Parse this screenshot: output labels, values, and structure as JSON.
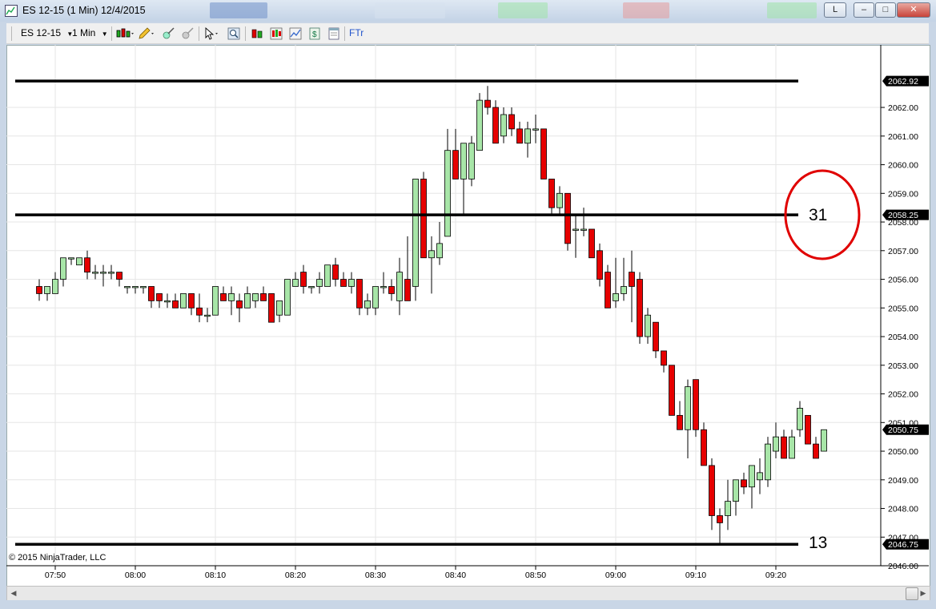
{
  "window": {
    "title": "ES 12-15 (1 Min)  12/4/2015",
    "buttons": {
      "link": "L",
      "minimize": "–",
      "maximize": "□",
      "close": "✕"
    }
  },
  "toolbar": {
    "instrument": "ES 12-15",
    "interval": "1 Min",
    "ftr_label": "FTr"
  },
  "chart": {
    "copyright": "© 2015 NinjaTrader, LLC",
    "y_ticks": [
      "2046.00",
      "2047.00",
      "2048.00",
      "2049.00",
      "2050.00",
      "2051.00",
      "2052.00",
      "2053.00",
      "2054.00",
      "2055.00",
      "2056.00",
      "2057.00",
      "2058.00",
      "2059.00",
      "2060.00",
      "2061.00",
      "2062.00"
    ],
    "x_ticks": [
      "07:50",
      "08:00",
      "08:10",
      "08:20",
      "08:30",
      "08:40",
      "08:50",
      "09:00",
      "09:10",
      "09:20"
    ],
    "price_labels": [
      "2062.92",
      "2058.25",
      "2050.75",
      "2046.75"
    ],
    "annotations": {
      "circle_value": "31",
      "bottom_value": "13"
    },
    "colors": {
      "up": "#a8e6a8",
      "down": "#e60000",
      "wick": "#000000",
      "line": "#000000",
      "circle": "#e00000"
    }
  },
  "chart_data": {
    "type": "candlestick",
    "instrument": "ES 12-15",
    "interval": "1 Min",
    "date": "12/4/2015",
    "ylim": [
      2045.8,
      2063.8
    ],
    "xlim": [
      "07:48",
      "09:35"
    ],
    "horizontal_lines": [
      2062.92,
      2058.25,
      2046.75
    ],
    "candles": [
      {
        "t": "07:48",
        "o": 2055.75,
        "h": 2056.0,
        "l": 2055.25,
        "c": 2055.5
      },
      {
        "t": "07:49",
        "o": 2055.5,
        "h": 2055.75,
        "l": 2055.25,
        "c": 2055.75
      },
      {
        "t": "07:50",
        "o": 2055.5,
        "h": 2056.25,
        "l": 2055.5,
        "c": 2056.0
      },
      {
        "t": "07:51",
        "o": 2056.0,
        "h": 2056.75,
        "l": 2055.75,
        "c": 2056.75
      },
      {
        "t": "07:52",
        "o": 2056.75,
        "h": 2056.75,
        "l": 2056.5,
        "c": 2056.75
      },
      {
        "t": "07:53",
        "o": 2056.5,
        "h": 2056.75,
        "l": 2056.5,
        "c": 2056.75
      },
      {
        "t": "07:54",
        "o": 2056.75,
        "h": 2057.0,
        "l": 2056.0,
        "c": 2056.25
      },
      {
        "t": "07:55",
        "o": 2056.25,
        "h": 2056.5,
        "l": 2056.0,
        "c": 2056.25
      },
      {
        "t": "07:56",
        "o": 2056.25,
        "h": 2056.5,
        "l": 2055.75,
        "c": 2056.25
      },
      {
        "t": "07:57",
        "o": 2056.25,
        "h": 2056.5,
        "l": 2056.0,
        "c": 2056.25
      },
      {
        "t": "07:58",
        "o": 2056.25,
        "h": 2056.25,
        "l": 2055.75,
        "c": 2056.0
      },
      {
        "t": "07:59",
        "o": 2055.75,
        "h": 2055.75,
        "l": 2055.5,
        "c": 2055.75
      },
      {
        "t": "08:00",
        "o": 2055.75,
        "h": 2055.75,
        "l": 2055.5,
        "c": 2055.75
      },
      {
        "t": "08:01",
        "o": 2055.75,
        "h": 2055.75,
        "l": 2055.5,
        "c": 2055.75
      },
      {
        "t": "08:02",
        "o": 2055.75,
        "h": 2055.75,
        "l": 2055.0,
        "c": 2055.25
      },
      {
        "t": "08:03",
        "o": 2055.5,
        "h": 2055.5,
        "l": 2055.0,
        "c": 2055.25
      },
      {
        "t": "08:04",
        "o": 2055.25,
        "h": 2055.5,
        "l": 2055.0,
        "c": 2055.25
      },
      {
        "t": "08:05",
        "o": 2055.25,
        "h": 2055.5,
        "l": 2055.0,
        "c": 2055.0
      },
      {
        "t": "08:06",
        "o": 2055.0,
        "h": 2055.5,
        "l": 2055.0,
        "c": 2055.5
      },
      {
        "t": "08:07",
        "o": 2055.5,
        "h": 2055.5,
        "l": 2054.75,
        "c": 2055.0
      },
      {
        "t": "08:08",
        "o": 2055.0,
        "h": 2055.5,
        "l": 2054.5,
        "c": 2054.75
      },
      {
        "t": "08:09",
        "o": 2054.75,
        "h": 2055.0,
        "l": 2054.5,
        "c": 2054.75
      },
      {
        "t": "08:10",
        "o": 2054.75,
        "h": 2055.75,
        "l": 2054.75,
        "c": 2055.75
      },
      {
        "t": "08:11",
        "o": 2055.5,
        "h": 2055.75,
        "l": 2055.25,
        "c": 2055.25
      },
      {
        "t": "08:12",
        "o": 2055.25,
        "h": 2055.75,
        "l": 2054.75,
        "c": 2055.5
      },
      {
        "t": "08:13",
        "o": 2055.25,
        "h": 2055.5,
        "l": 2054.5,
        "c": 2055.0
      },
      {
        "t": "08:14",
        "o": 2055.0,
        "h": 2055.75,
        "l": 2055.0,
        "c": 2055.5
      },
      {
        "t": "08:15",
        "o": 2055.25,
        "h": 2055.5,
        "l": 2055.0,
        "c": 2055.5
      },
      {
        "t": "08:16",
        "o": 2055.5,
        "h": 2055.75,
        "l": 2055.25,
        "c": 2055.25
      },
      {
        "t": "08:17",
        "o": 2055.5,
        "h": 2055.5,
        "l": 2054.5,
        "c": 2054.5
      },
      {
        "t": "08:18",
        "o": 2054.75,
        "h": 2055.25,
        "l": 2054.5,
        "c": 2055.25
      },
      {
        "t": "08:19",
        "o": 2054.75,
        "h": 2056.0,
        "l": 2054.75,
        "c": 2056.0
      },
      {
        "t": "08:20",
        "o": 2055.75,
        "h": 2056.25,
        "l": 2055.75,
        "c": 2056.0
      },
      {
        "t": "08:21",
        "o": 2056.25,
        "h": 2056.5,
        "l": 2055.5,
        "c": 2055.75
      },
      {
        "t": "08:22",
        "o": 2055.75,
        "h": 2055.75,
        "l": 2055.5,
        "c": 2055.75
      },
      {
        "t": "08:23",
        "o": 2055.75,
        "h": 2056.25,
        "l": 2055.5,
        "c": 2056.0
      },
      {
        "t": "08:24",
        "o": 2055.75,
        "h": 2056.5,
        "l": 2055.75,
        "c": 2056.5
      },
      {
        "t": "08:25",
        "o": 2056.5,
        "h": 2056.75,
        "l": 2055.75,
        "c": 2056.0
      },
      {
        "t": "08:26",
        "o": 2056.0,
        "h": 2056.25,
        "l": 2055.75,
        "c": 2055.75
      },
      {
        "t": "08:27",
        "o": 2055.75,
        "h": 2056.25,
        "l": 2055.5,
        "c": 2056.0
      },
      {
        "t": "08:28",
        "o": 2056.0,
        "h": 2056.0,
        "l": 2054.75,
        "c": 2055.0
      },
      {
        "t": "08:29",
        "o": 2055.0,
        "h": 2055.5,
        "l": 2054.75,
        "c": 2055.25
      },
      {
        "t": "08:30",
        "o": 2055.0,
        "h": 2055.75,
        "l": 2054.75,
        "c": 2055.75
      },
      {
        "t": "08:31",
        "o": 2055.75,
        "h": 2056.25,
        "l": 2055.5,
        "c": 2055.75
      },
      {
        "t": "08:32",
        "o": 2055.75,
        "h": 2056.0,
        "l": 2055.25,
        "c": 2055.5
      },
      {
        "t": "08:33",
        "o": 2055.25,
        "h": 2056.75,
        "l": 2054.75,
        "c": 2056.25
      },
      {
        "t": "08:34",
        "o": 2056.0,
        "h": 2057.5,
        "l": 2055.25,
        "c": 2055.25
      },
      {
        "t": "08:35",
        "o": 2055.75,
        "h": 2059.5,
        "l": 2055.25,
        "c": 2059.5
      },
      {
        "t": "08:36",
        "o": 2059.5,
        "h": 2059.75,
        "l": 2056.75,
        "c": 2056.75
      },
      {
        "t": "08:37",
        "o": 2056.75,
        "h": 2057.5,
        "l": 2055.5,
        "c": 2057.0
      },
      {
        "t": "08:38",
        "o": 2056.75,
        "h": 2058.0,
        "l": 2056.5,
        "c": 2057.25
      },
      {
        "t": "08:39",
        "o": 2057.5,
        "h": 2061.25,
        "l": 2057.5,
        "c": 2060.5
      },
      {
        "t": "08:40",
        "o": 2060.5,
        "h": 2061.25,
        "l": 2059.5,
        "c": 2059.5
      },
      {
        "t": "08:41",
        "o": 2059.5,
        "h": 2060.75,
        "l": 2058.25,
        "c": 2060.75
      },
      {
        "t": "08:42",
        "o": 2059.5,
        "h": 2061.0,
        "l": 2059.25,
        "c": 2060.75
      },
      {
        "t": "08:43",
        "o": 2060.5,
        "h": 2062.5,
        "l": 2060.5,
        "c": 2062.25
      },
      {
        "t": "08:44",
        "o": 2062.25,
        "h": 2062.75,
        "l": 2061.75,
        "c": 2062.0
      },
      {
        "t": "08:45",
        "o": 2062.0,
        "h": 2062.25,
        "l": 2060.75,
        "c": 2060.75
      },
      {
        "t": "08:46",
        "o": 2061.0,
        "h": 2062.0,
        "l": 2060.75,
        "c": 2061.75
      },
      {
        "t": "08:47",
        "o": 2061.75,
        "h": 2062.0,
        "l": 2061.0,
        "c": 2061.25
      },
      {
        "t": "08:48",
        "o": 2061.25,
        "h": 2061.5,
        "l": 2060.75,
        "c": 2060.75
      },
      {
        "t": "08:49",
        "o": 2060.75,
        "h": 2061.5,
        "l": 2060.25,
        "c": 2061.25
      },
      {
        "t": "08:50",
        "o": 2061.25,
        "h": 2061.75,
        "l": 2060.75,
        "c": 2061.25
      },
      {
        "t": "08:51",
        "o": 2061.25,
        "h": 2061.25,
        "l": 2059.5,
        "c": 2059.5
      },
      {
        "t": "08:52",
        "o": 2059.5,
        "h": 2059.5,
        "l": 2058.25,
        "c": 2058.5
      },
      {
        "t": "08:53",
        "o": 2058.5,
        "h": 2059.25,
        "l": 2058.25,
        "c": 2059.0
      },
      {
        "t": "08:54",
        "o": 2059.0,
        "h": 2059.0,
        "l": 2057.0,
        "c": 2057.25
      },
      {
        "t": "08:55",
        "o": 2057.75,
        "h": 2058.25,
        "l": 2056.75,
        "c": 2057.75
      },
      {
        "t": "08:56",
        "o": 2057.75,
        "h": 2058.5,
        "l": 2057.5,
        "c": 2057.75
      },
      {
        "t": "08:57",
        "o": 2057.75,
        "h": 2057.75,
        "l": 2056.75,
        "c": 2056.75
      },
      {
        "t": "08:58",
        "o": 2057.0,
        "h": 2057.25,
        "l": 2055.75,
        "c": 2056.0
      },
      {
        "t": "08:59",
        "o": 2056.25,
        "h": 2056.5,
        "l": 2055.0,
        "c": 2055.0
      },
      {
        "t": "09:00",
        "o": 2055.25,
        "h": 2056.75,
        "l": 2055.0,
        "c": 2055.5
      },
      {
        "t": "09:01",
        "o": 2055.5,
        "h": 2056.75,
        "l": 2055.25,
        "c": 2055.75
      },
      {
        "t": "09:02",
        "o": 2056.25,
        "h": 2057.0,
        "l": 2054.5,
        "c": 2055.75
      },
      {
        "t": "09:03",
        "o": 2056.0,
        "h": 2056.25,
        "l": 2053.75,
        "c": 2054.0
      },
      {
        "t": "09:04",
        "o": 2054.0,
        "h": 2055.0,
        "l": 2053.75,
        "c": 2054.75
      },
      {
        "t": "09:05",
        "o": 2054.5,
        "h": 2054.5,
        "l": 2053.25,
        "c": 2053.5
      },
      {
        "t": "09:06",
        "o": 2053.5,
        "h": 2053.5,
        "l": 2052.75,
        "c": 2053.0
      },
      {
        "t": "09:07",
        "o": 2053.0,
        "h": 2053.0,
        "l": 2051.25,
        "c": 2051.25
      },
      {
        "t": "09:08",
        "o": 2051.25,
        "h": 2051.75,
        "l": 2050.75,
        "c": 2050.75
      },
      {
        "t": "09:09",
        "o": 2050.75,
        "h": 2052.5,
        "l": 2049.75,
        "c": 2052.25
      },
      {
        "t": "09:10",
        "o": 2052.5,
        "h": 2052.5,
        "l": 2050.5,
        "c": 2050.75
      },
      {
        "t": "09:11",
        "o": 2050.75,
        "h": 2051.0,
        "l": 2049.5,
        "c": 2049.5
      },
      {
        "t": "09:12",
        "o": 2049.5,
        "h": 2049.75,
        "l": 2047.25,
        "c": 2047.75
      },
      {
        "t": "09:13",
        "o": 2047.75,
        "h": 2048.0,
        "l": 2046.75,
        "c": 2047.5
      },
      {
        "t": "09:14",
        "o": 2047.75,
        "h": 2049.0,
        "l": 2047.25,
        "c": 2048.25
      },
      {
        "t": "09:15",
        "o": 2048.25,
        "h": 2049.0,
        "l": 2047.75,
        "c": 2049.0
      },
      {
        "t": "09:16",
        "o": 2049.0,
        "h": 2049.25,
        "l": 2048.5,
        "c": 2048.75
      },
      {
        "t": "09:17",
        "o": 2048.75,
        "h": 2049.5,
        "l": 2048.0,
        "c": 2049.5
      },
      {
        "t": "09:18",
        "o": 2049.0,
        "h": 2049.75,
        "l": 2048.5,
        "c": 2049.25
      },
      {
        "t": "09:19",
        "o": 2049.0,
        "h": 2050.5,
        "l": 2048.75,
        "c": 2050.25
      },
      {
        "t": "09:20",
        "o": 2050.0,
        "h": 2051.0,
        "l": 2049.75,
        "c": 2050.5
      },
      {
        "t": "09:21",
        "o": 2050.5,
        "h": 2050.75,
        "l": 2049.75,
        "c": 2049.75
      },
      {
        "t": "09:22",
        "o": 2049.75,
        "h": 2050.75,
        "l": 2049.75,
        "c": 2050.5
      },
      {
        "t": "09:23",
        "o": 2050.75,
        "h": 2051.75,
        "l": 2050.5,
        "c": 2051.5
      },
      {
        "t": "09:24",
        "o": 2051.25,
        "h": 2051.25,
        "l": 2050.25,
        "c": 2050.25
      },
      {
        "t": "09:25",
        "o": 2050.25,
        "h": 2050.5,
        "l": 2049.75,
        "c": 2049.75
      },
      {
        "t": "09:26",
        "o": 2050.0,
        "h": 2050.75,
        "l": 2050.0,
        "c": 2050.75
      }
    ]
  }
}
